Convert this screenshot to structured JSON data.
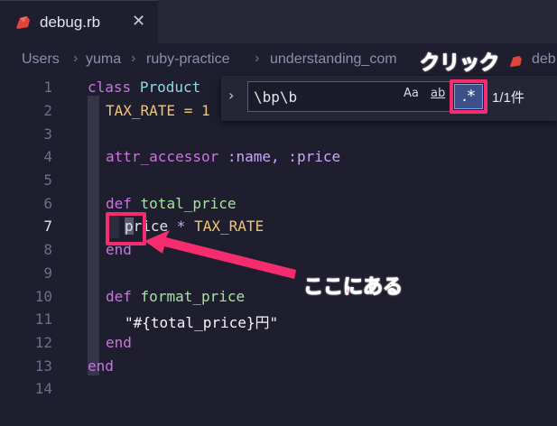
{
  "tab": {
    "filename": "debug.rb",
    "close_glyph": "✕",
    "icon": "ruby-icon"
  },
  "breadcrumb": {
    "items": [
      "Users",
      "yuma",
      "ruby-practice",
      "understanding_com"
    ],
    "trailing": "deb"
  },
  "lines": [
    {
      "n": "1"
    },
    {
      "n": "2"
    },
    {
      "n": "3"
    },
    {
      "n": "4"
    },
    {
      "n": "5"
    },
    {
      "n": "6"
    },
    {
      "n": "7"
    },
    {
      "n": "8"
    },
    {
      "n": "9"
    },
    {
      "n": "10"
    },
    {
      "n": "11"
    },
    {
      "n": "12"
    },
    {
      "n": "13"
    },
    {
      "n": "14"
    }
  ],
  "code": {
    "l1_kw": "class",
    "l1_name": "Product",
    "l2": "TAX_RATE = 1",
    "l4_kw": "attr_accessor",
    "l4_rest": ":name, :price",
    "l6_kw": "def",
    "l6_name": "total_price",
    "l7_match": "p",
    "l7_rest": "rice",
    "l7_op": " * ",
    "l7_const": "TAX_RATE",
    "l8": "end",
    "l10_kw": "def",
    "l10_name": "format_price",
    "l11": "\"#{total_price}円\"",
    "l12": "end",
    "l13": "end"
  },
  "find": {
    "query": "\\bp\\b",
    "match_case": "Aa",
    "whole_word": "ab",
    "regex": ".*",
    "count": "1/1件"
  },
  "annotations": {
    "click_label": "クリック",
    "here_label": "ここにある",
    "color": "#f72c6e"
  }
}
